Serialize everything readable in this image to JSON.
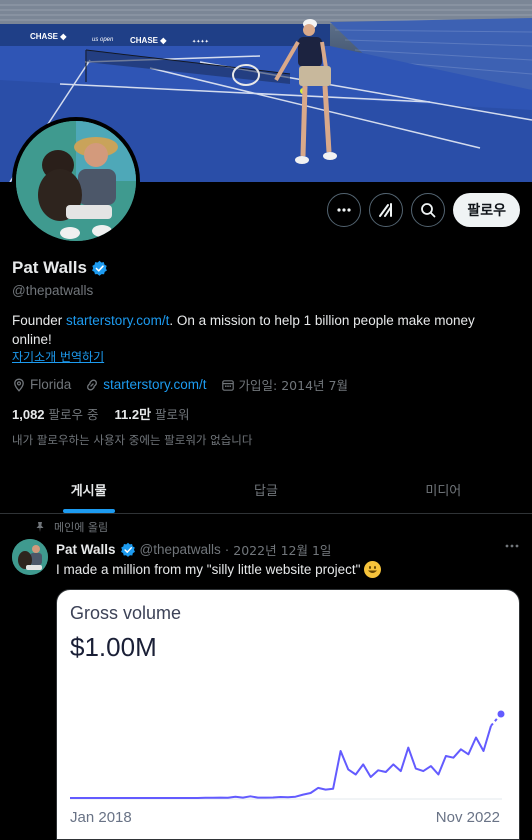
{
  "profile": {
    "name": "Pat Walls",
    "handle": "@thepatwalls",
    "bio_prefix": "Founder ",
    "bio_link": "starterstory.com/t",
    "bio_suffix": ". On a mission to help 1 billion people make money online!",
    "translate_label": "자기소개 번역하기",
    "location": "Florida",
    "website": "starterstory.com/t",
    "joined": "가입일: 2014년 7월",
    "following_count": "1,082",
    "following_label": "팔로우 중",
    "followers_count": "11.2만",
    "followers_label": "팔로워",
    "mutual_note": "내가 팔로우하는 사용자 중에는 팔로워가 없습니다"
  },
  "actions": {
    "more_icon": "more-icon",
    "grok_icon": "grok-icon",
    "search_icon": "search-icon",
    "follow_label": "팔로우"
  },
  "tabs": [
    {
      "label": "게시물",
      "active": true
    },
    {
      "label": "답글",
      "active": false
    },
    {
      "label": "미디어",
      "active": false
    }
  ],
  "post": {
    "pinned_label": "메인에 올림",
    "author_name": "Pat Walls",
    "author_handle": "@thepatwalls",
    "separator": "·",
    "date": "2022년 12월 1일",
    "text": "I made a million from my \"silly little website project\"",
    "emoji": "grinning-face"
  },
  "chart_data": {
    "type": "line",
    "title": "Gross volume",
    "value_label": "$1.00M",
    "x_start_label": "Jan 2018",
    "x_end_label": "Nov 2022",
    "series": [
      {
        "values": [
          0,
          0,
          0,
          0,
          0,
          0,
          0,
          0,
          0,
          0,
          0,
          0,
          0,
          0,
          0,
          0,
          0,
          0,
          0.2,
          0.3,
          0.5,
          0.4,
          1.5,
          0.5,
          2,
          0.5,
          0.5,
          0.6,
          1.2,
          1.0,
          1.6,
          4,
          6,
          12,
          10,
          11,
          56,
          34,
          28,
          40,
          25,
          33,
          31,
          40,
          32,
          60,
          35,
          32,
          38,
          28,
          50,
          48,
          58,
          52,
          72,
          56,
          86
        ]
      }
    ],
    "projected_end": 100,
    "line_color": "#635bff",
    "ylim": [
      0,
      100
    ]
  },
  "colors": {
    "accent": "#1d9bf0",
    "background": "#000000",
    "muted": "#71767b"
  }
}
